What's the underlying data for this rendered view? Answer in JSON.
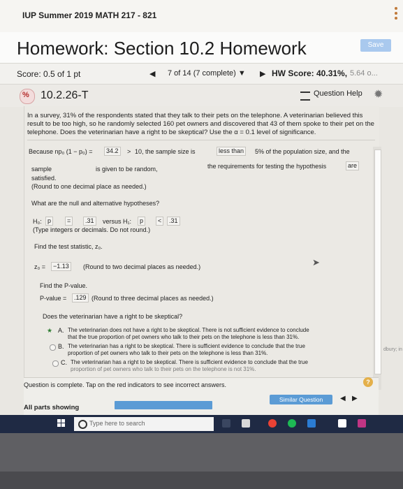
{
  "header": {
    "course_title": "IUP Summer 2019 MATH 217 - 821",
    "homework_title": "Homework: Section 10.2 Homework",
    "save_label": "Save"
  },
  "score_row": {
    "score": "Score: 0.5 of 1 pt",
    "progress": "7 of 14 (7 complete) ▼",
    "hw_score": "HW Score: 40.31%,",
    "hw_score_detail": "5.64 o..."
  },
  "question_row": {
    "number": "10.2.26-T",
    "help_label": "Question Help"
  },
  "problem": {
    "text": "In a survey, 31% of the respondents stated that they talk to their pets on the telephone. A veterinarian believed this result to be too high, so he randomly selected 160 pet owners and discovered that 43 of them spoke to their pet on the telephone. Does the veterinarian have a right to be skeptical? Use the α = 0.1 level of significance."
  },
  "condition": {
    "because": "Because np₀ (1 − p₀) =",
    "value": "34.2",
    "gt": ">",
    "ten": "10, the sample size is",
    "size_answer": "less than",
    "pop_text": "5% of the population size, and the",
    "sample": "sample",
    "given": "is given to be random,",
    "requirements": "the requirements for testing the hypothesis",
    "are": "are",
    "satisfied": "satisfied.",
    "round_note": "(Round to one decimal place as needed.)"
  },
  "hypotheses": {
    "question": "What are the null and alternative hypotheses?",
    "h0_label": "H₀:",
    "h0_param": "p",
    "h0_op": "=",
    "h0_val": ".31",
    "versus": "versus H₁:",
    "h1_param": "p",
    "h1_op": "<",
    "h1_val": ".31",
    "note": "(Type integers or decimals. Do not round.)"
  },
  "test_stat": {
    "prompt": "Find the test statistic, z₀.",
    "label": "z₀ =",
    "value": "−1.13",
    "note": "(Round to two decimal places as needed.)"
  },
  "pvalue": {
    "prompt": "Find the P-value.",
    "label": "P-value =",
    "value": ".129",
    "note": "(Round to three decimal places as needed.)"
  },
  "skeptical": {
    "question": "Does the veterinarian have a right to be skeptical?",
    "choices": [
      {
        "letter": "A.",
        "line1": "The veterinarian does not have a right to be skeptical. There is not sufficient evidence to conclude",
        "line2": "that the true proportion of pet owners who talk to their pets on the telephone is less than 31%."
      },
      {
        "letter": "B.",
        "line1": "The veterinarian has a right to be skeptical. There is sufficient evidence to conclude that the true",
        "line2": "proportion of pet owners who talk to their pets on the telephone is less than 31%."
      },
      {
        "letter": "C.",
        "line1": "The veterinarian has a right to be skeptical. There is sufficient evidence to conclude that the true",
        "line2": "proportion of pet owners who talk to their pets on the telephone is not 31%."
      }
    ]
  },
  "footer": {
    "message": "Question is complete. Tap on the red indicators to see incorrect answers.",
    "all_parts": "All parts showing",
    "similar": "Similar Question"
  },
  "taskbar": {
    "search_placeholder": "Type here to search"
  },
  "side_text": "dbury; in",
  "colors": {
    "accent_blue": "#5b9bd5",
    "save_disabled": "#a9c9ee",
    "taskbar": "#1f2a44",
    "incorrect_red": "#b42a2a"
  }
}
